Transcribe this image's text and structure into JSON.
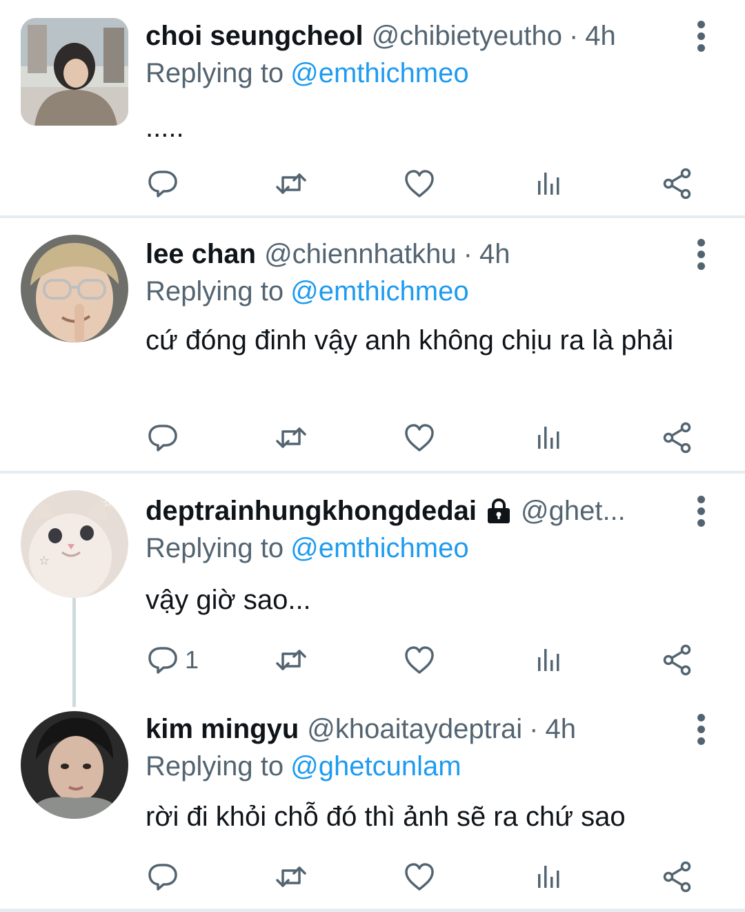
{
  "tweets": [
    {
      "name": "choi seungcheol",
      "handle": "@chibietyeutho",
      "separator": "·",
      "time": "4h",
      "replying_label": "Replying to",
      "replying_to": "@emthichmeo",
      "text": ".....",
      "reply_count": "",
      "avatar_icon": "avatar-photo"
    },
    {
      "name": "lee chan",
      "handle": "@chiennhatkhu",
      "separator": "·",
      "time": "4h",
      "replying_label": "Replying to",
      "replying_to": "@emthichmeo",
      "text": "cứ đóng đinh vậy anh không chịu ra là phải",
      "reply_count": "",
      "avatar_icon": "avatar-photo"
    },
    {
      "name": "deptrainhungkhongdedai",
      "handle": "@ghet...",
      "separator": "",
      "time": "",
      "protected_icon": "lock-icon",
      "replying_label": "Replying to",
      "replying_to": "@emthichmeo",
      "text": "vậy giờ sao...",
      "reply_count": "1",
      "avatar_icon": "avatar-cat-photo"
    },
    {
      "name": "kim mingyu",
      "handle": "@khoaitaydeptrai",
      "separator": "·",
      "time": "4h",
      "replying_label": "Replying to",
      "replying_to": "@ghetcunlam",
      "text": "rời đi khỏi chỗ đó thì ảnh sẽ ra chứ sao",
      "reply_count": "",
      "avatar_icon": "avatar-photo"
    }
  ],
  "action_icons": [
    "reply-icon",
    "retweet-icon",
    "like-icon",
    "analytics-icon",
    "share-icon"
  ],
  "colors": {
    "text": "#0f1419",
    "muted": "#536471",
    "link": "#1d9bf0",
    "divider": "#e6ecf0",
    "thread_line": "#cfd9de"
  }
}
